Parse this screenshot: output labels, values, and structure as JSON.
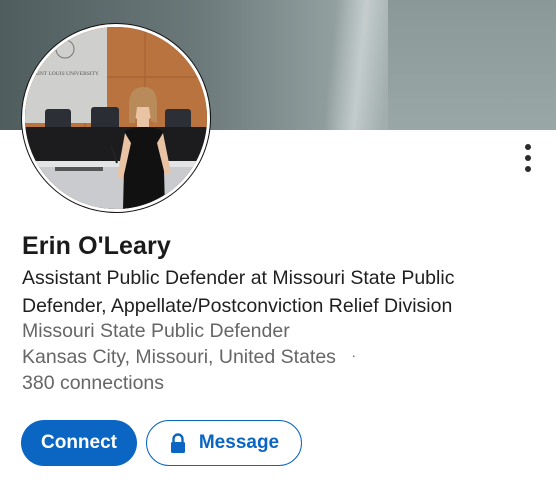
{
  "profile": {
    "name": "Erin O'Leary",
    "headline": "Assistant Public Defender at Missouri State Public Defender, Appellate/Postconviction Relief Division",
    "company": "Missouri State Public Defender",
    "location": "Kansas City, Missouri, United States",
    "location_separator": "·",
    "connections": "380 connections",
    "photo_sign_text": "SAINT LOUIS UNIVERSITY"
  },
  "actions": {
    "connect_label": "Connect",
    "message_label": "Message"
  },
  "icons": {
    "more": "more-vertical-icon",
    "lock": "lock-icon"
  },
  "colors": {
    "accent": "#0a66c2",
    "secondary_text": "#666666",
    "primary_text": "#1a1a1a"
  }
}
